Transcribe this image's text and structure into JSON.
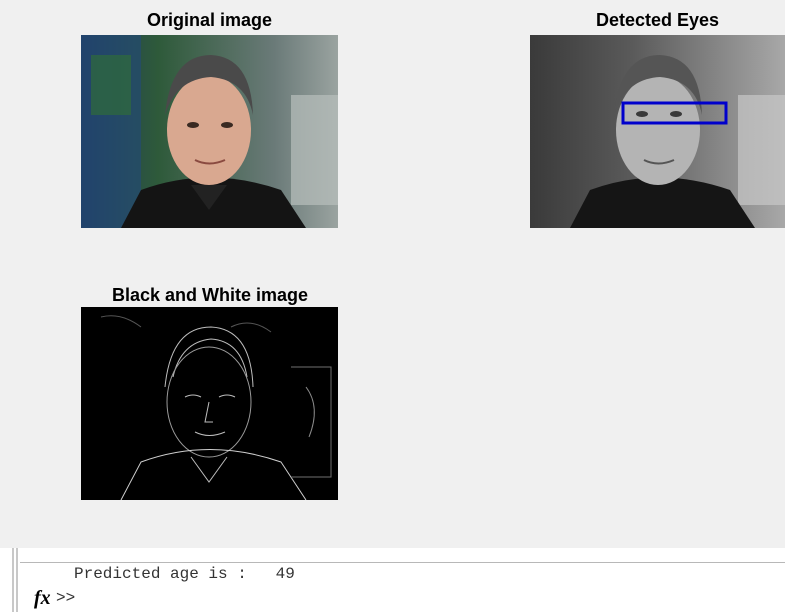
{
  "figure": {
    "panels": [
      {
        "title": "Original image",
        "image": "portrait-color"
      },
      {
        "title": "Detected Eyes",
        "image": "portrait-grayscale-with-eye-box",
        "box_color": "#0000cc"
      },
      {
        "title": "Black and White image",
        "image": "portrait-edge-map"
      }
    ]
  },
  "command_window": {
    "output_text": "Predicted age is :   49",
    "prompt": ">>",
    "fx_label": "fx"
  }
}
